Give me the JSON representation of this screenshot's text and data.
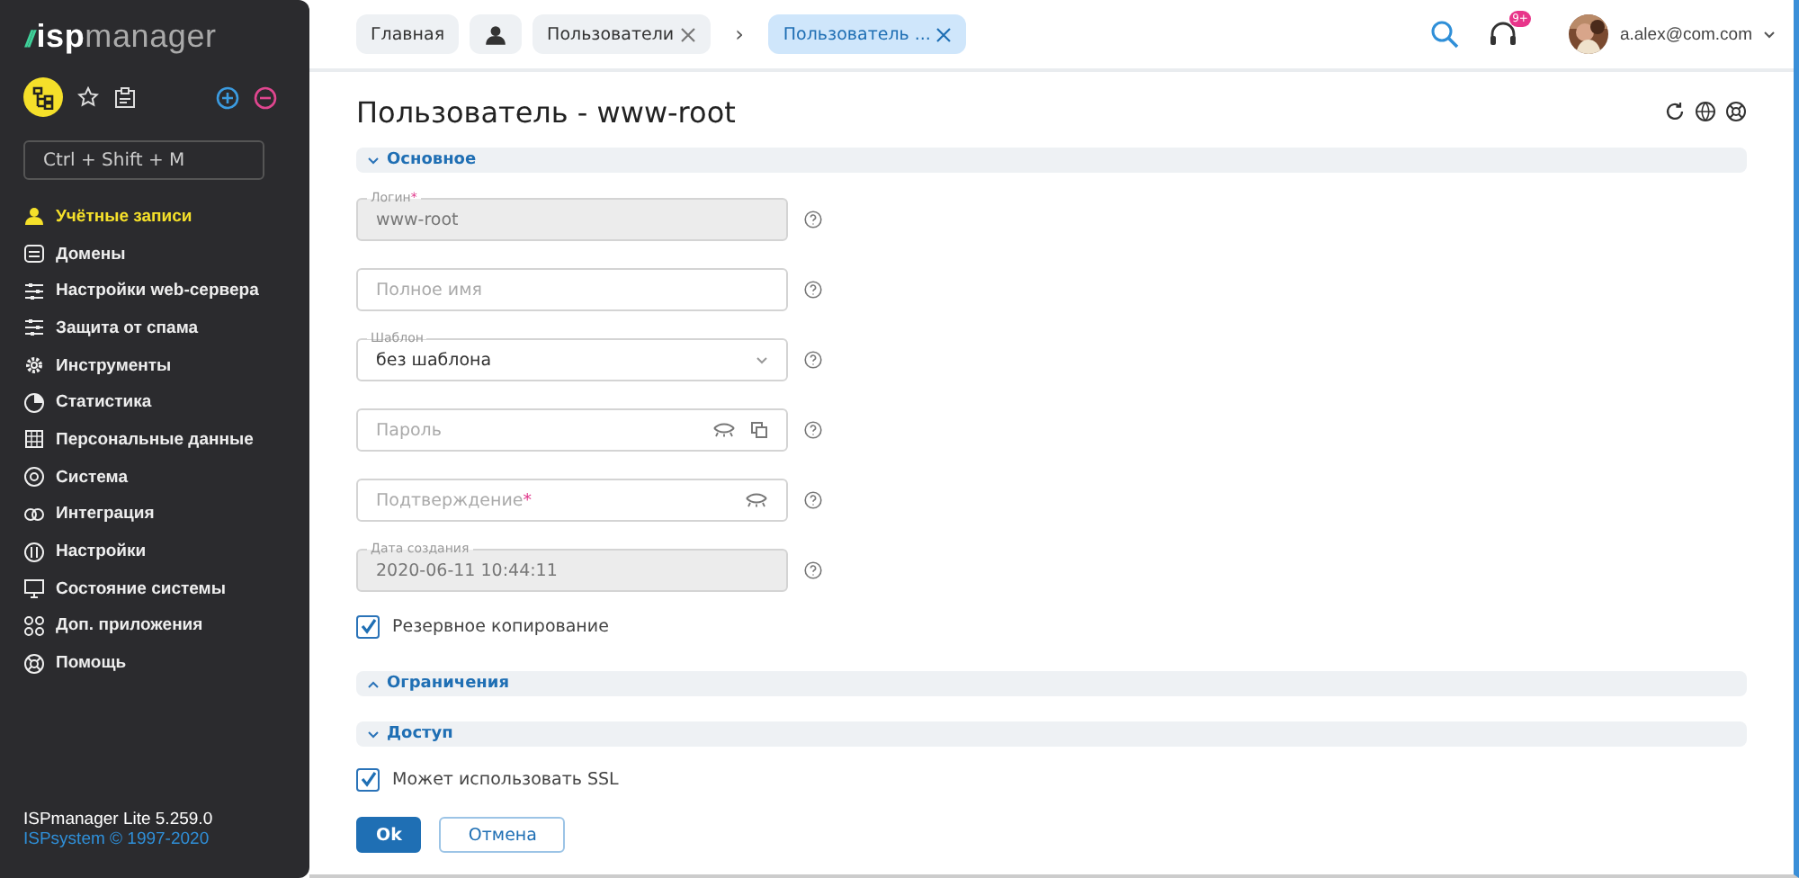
{
  "sidebar": {
    "logo_mark": "//",
    "logo_bold": "isp",
    "logo_rest": "manager",
    "search_placeholder": "Ctrl + Shift + M",
    "items": [
      {
        "label": "Учётные записи",
        "selected": true
      },
      {
        "label": "Домены",
        "selected": false
      },
      {
        "label": "Настройки web-сервера",
        "selected": false
      },
      {
        "label": "Защита от спама",
        "selected": false
      },
      {
        "label": "Инструменты",
        "selected": false
      },
      {
        "label": "Статистика",
        "selected": false
      },
      {
        "label": "Персональные данные",
        "selected": false
      },
      {
        "label": "Система",
        "selected": false
      },
      {
        "label": "Интеграция",
        "selected": false
      },
      {
        "label": "Настройки",
        "selected": false
      },
      {
        "label": "Состояние системы",
        "selected": false
      },
      {
        "label": "Доп. приложения",
        "selected": false
      },
      {
        "label": "Помощь",
        "selected": false
      }
    ],
    "version": "ISPmanager Lite 5.259.0",
    "copyright": "ISPsystem © 1997-2020"
  },
  "tabs": [
    {
      "kind": "text",
      "label": "Главная",
      "selected": false,
      "closable": false
    },
    {
      "kind": "icon",
      "selected": false
    },
    {
      "kind": "text",
      "label": "Пользователи",
      "selected": false,
      "closable": true
    },
    {
      "kind": "separator",
      "label": "›"
    },
    {
      "kind": "text",
      "label": "Пользователь ...",
      "selected": true,
      "closable": true
    }
  ],
  "header": {
    "notifications": "9+",
    "user": "a.alex@com.com"
  },
  "title": "Пользователь - www-root",
  "sections": [
    {
      "title": "Основное",
      "expanded": true,
      "fields": [
        {
          "kind": "text",
          "label": "Логин",
          "required_mark": "*",
          "value": "www-root",
          "disabled": true
        },
        {
          "kind": "text",
          "placeholder": "Полное имя",
          "disabled": false
        },
        {
          "kind": "select",
          "label": "Шаблон",
          "value": "без шаблона",
          "disabled": false
        },
        {
          "kind": "password",
          "placeholder": "Пароль",
          "generator": true,
          "disabled": false
        },
        {
          "kind": "password",
          "placeholder": "Подтверждение",
          "required_mark": "*",
          "generator": false,
          "disabled": false
        },
        {
          "kind": "text",
          "label": "Дата создания",
          "value": "2020-06-11 10:44:11",
          "disabled": true
        },
        {
          "kind": "checkbox",
          "label": "Резервное копирование",
          "checked": true
        }
      ]
    },
    {
      "title": "Ограничения",
      "expanded": false
    },
    {
      "title": "Доступ",
      "expanded": true,
      "fields": [
        {
          "kind": "checkbox",
          "label": "Может использовать SSL",
          "checked": true
        }
      ]
    }
  ],
  "buttons": [
    {
      "label": "Ok",
      "kind": "primary"
    },
    {
      "label": "Отмена",
      "kind": "secondary"
    }
  ]
}
